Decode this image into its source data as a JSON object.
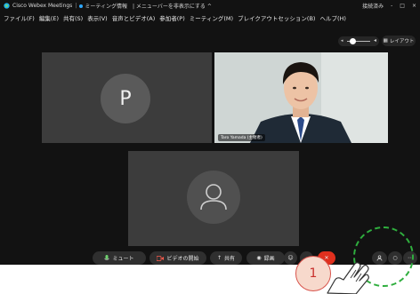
{
  "titlebar": {
    "app_name": "Cisco Webex Meetings",
    "meeting_label": "ミーティング情報",
    "controls_hint": "| メニューバーを非表示にする ^",
    "connection_status": "接続済み",
    "window_controls": [
      "-",
      "□",
      "×"
    ]
  },
  "menubar": {
    "items": [
      "ファイル(F)",
      "編集(E)",
      "共有(S)",
      "表示(V)",
      "音声とビデオ(A)",
      "参加者(P)",
      "ミーティング(M)",
      "ブレイクアウトセッション(B)",
      "ヘルプ(H)"
    ]
  },
  "toolbar": {
    "volume_level": 0.25,
    "layout_label": "レイアウト"
  },
  "tiles": {
    "p_initial": "P",
    "photo_name": "Taro Yamada (主催者)"
  },
  "controls": {
    "mute_label": "ミュート",
    "video_label": "ビデオの開始",
    "share_label": "共有",
    "record_label": "録画"
  },
  "annotation": {
    "step_number": "1"
  },
  "colors": {
    "app_bg": "#121212",
    "tile_bg": "#3c3c3c",
    "end_button": "#e0301e",
    "highlight_circle": "#2fae3e",
    "step_badge_border": "#d8524a"
  },
  "icons": [
    "webex-logo-icon",
    "microphone-icon",
    "video-camera-icon",
    "share-icon",
    "record-icon",
    "emoji-icon",
    "more-icon",
    "end-call-icon",
    "participants-icon",
    "chat-icon",
    "hand-pointer-icon"
  ]
}
